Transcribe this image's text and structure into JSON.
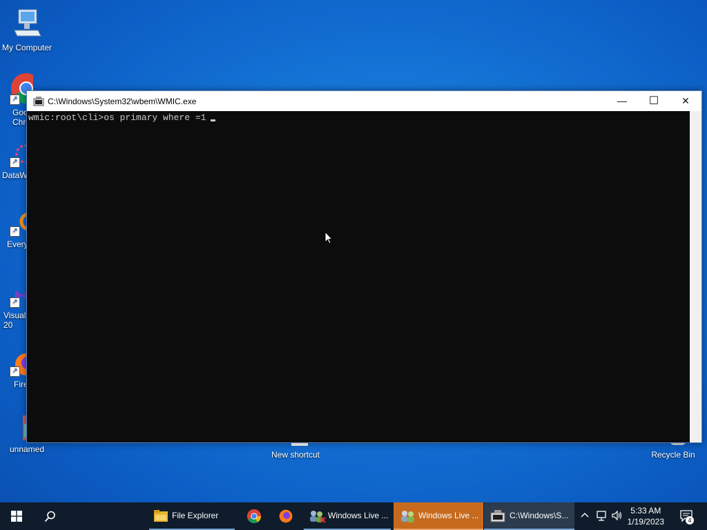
{
  "desktop": {
    "icons": [
      {
        "label": "My Computer"
      },
      {
        "label": "Goo\nChro"
      },
      {
        "label": "DataW"
      },
      {
        "label": "Every"
      },
      {
        "label": "Visual\n20"
      },
      {
        "label": "Fire"
      },
      {
        "label": "unnamed"
      },
      {
        "label": "New shortcut"
      },
      {
        "label": "Recycle Bin"
      }
    ]
  },
  "console": {
    "title": "C:\\Windows\\System32\\wbem\\WMIC.exe",
    "minimize_glyph": "—",
    "maximize_glyph": "☐",
    "close_glyph": "✕",
    "prompt_line": "wmic:root\\cli>os primary where =1"
  },
  "taskbar": {
    "start_icon": "windows-logo-icon",
    "search_icon": "search-icon",
    "items": [
      {
        "label": "File Explorer",
        "icon": "folder-icon"
      },
      {
        "label": "",
        "icon": "chrome-icon"
      },
      {
        "label": "",
        "icon": "firefox-icon"
      },
      {
        "label": "Windows Live ...",
        "icon": "windows-live-icon"
      },
      {
        "label": "Windows Live ...",
        "icon": "windows-live-icon",
        "active": true,
        "color": "#c66a1e"
      },
      {
        "label": "C:\\Windows\\S...",
        "icon": "console-icon",
        "active": true
      }
    ],
    "tray": {
      "chevron": "^",
      "time": "5:33 AM",
      "date": "1/19/2023",
      "notifications": "4"
    }
  }
}
